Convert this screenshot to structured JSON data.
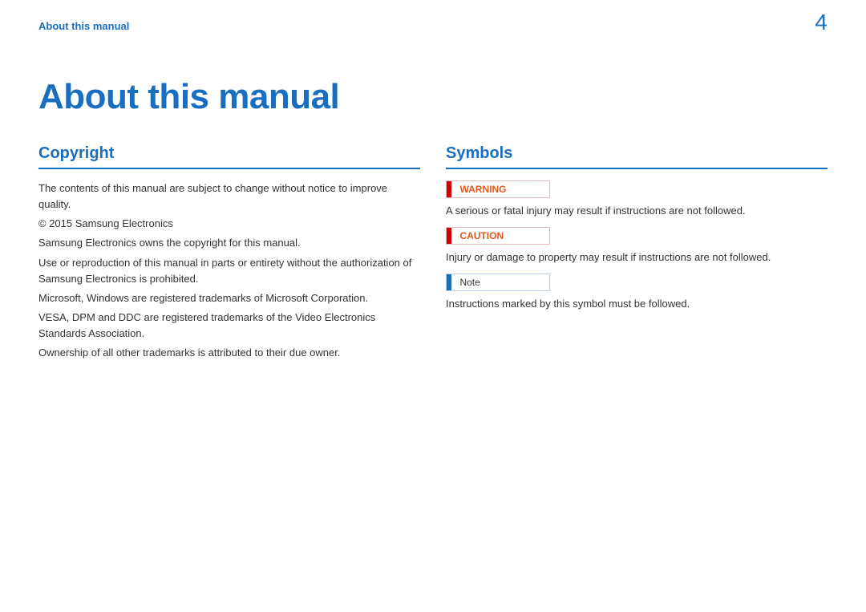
{
  "header": {
    "running_head": "About this manual",
    "page_number": "4"
  },
  "chapter": {
    "title": "About this manual"
  },
  "left": {
    "section_title": "Copyright",
    "p1": "The contents of this manual are subject to change without notice to improve quality.",
    "p2": "© 2015 Samsung Electronics",
    "p3": "Samsung Electronics owns the copyright for this manual.",
    "p4": "Use or reproduction of this manual in parts or entirety without the authorization of Samsung Electronics is prohibited.",
    "p5": "Microsoft, Windows are registered trademarks of Microsoft Corporation.",
    "p6": "VESA, DPM and DDC are registered trademarks of the Video Electronics Standards Association.",
    "p7": "Ownership of all other trademarks is attributed to their due owner."
  },
  "right": {
    "section_title": "Symbols",
    "warning_label": "WARNING",
    "warning_text": "A serious or fatal injury may result if instructions are not followed.",
    "caution_label": "CAUTION",
    "caution_text": "Injury or damage to property may result if instructions are not followed.",
    "note_label": "Note",
    "note_text": "Instructions marked by this symbol must be followed."
  }
}
